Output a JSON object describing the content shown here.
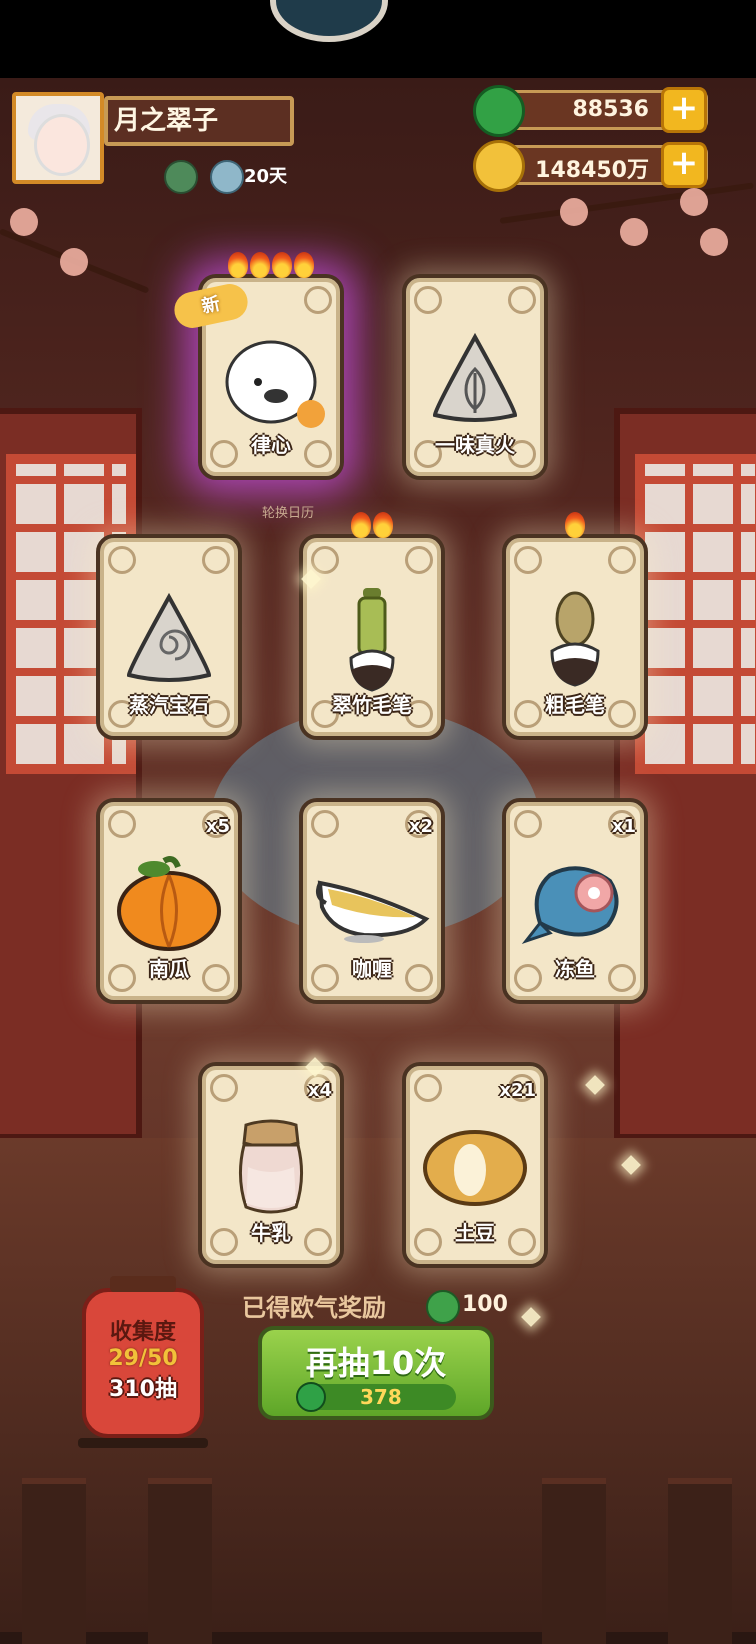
{
  "player": {
    "name": "月之翠子",
    "days": "20天"
  },
  "currency": {
    "jade": "88536",
    "gold": "148450万"
  },
  "rotate_hint": "轮换日历",
  "cards": [
    {
      "label": "律心",
      "count": "",
      "flames": 4,
      "new": "新",
      "glow": "purple",
      "icon": "white-bird-icon"
    },
    {
      "label": "一味真火",
      "count": "",
      "flames": 0,
      "new": "",
      "glow": "light",
      "icon": "leaf-stone-icon"
    },
    {
      "label": "蒸汽宝石",
      "count": "",
      "flames": 0,
      "new": "",
      "glow": "light",
      "icon": "swirl-stone-icon"
    },
    {
      "label": "翠竹毛笔",
      "count": "",
      "flames": 2,
      "new": "",
      "glow": "light",
      "icon": "bamboo-brush-icon"
    },
    {
      "label": "粗毛笔",
      "count": "",
      "flames": 1,
      "new": "",
      "glow": "light",
      "icon": "coarse-brush-icon"
    },
    {
      "label": "南瓜",
      "count": "x5",
      "flames": 0,
      "new": "",
      "glow": "light",
      "icon": "pumpkin-icon"
    },
    {
      "label": "咖喱",
      "count": "x2",
      "flames": 0,
      "new": "",
      "glow": "light",
      "icon": "curry-boat-icon"
    },
    {
      "label": "冻鱼",
      "count": "x1",
      "flames": 0,
      "new": "",
      "glow": "light",
      "icon": "frozen-fish-icon"
    },
    {
      "label": "牛乳",
      "count": "x4",
      "flames": 0,
      "new": "",
      "glow": "light",
      "icon": "milk-jar-icon"
    },
    {
      "label": "土豆",
      "count": "x21",
      "flames": 0,
      "new": "",
      "glow": "light",
      "icon": "potato-icon"
    }
  ],
  "collection": {
    "title": "收集度",
    "progress": "29/50",
    "draws": "310抽"
  },
  "reward": {
    "label": "已得欧气奖励",
    "value": "100"
  },
  "draw_button": {
    "label": "再抽10次",
    "cost": "378"
  },
  "colors": {
    "accent_green": "#5ea628",
    "gold": "#f2b71f",
    "card_bg": "#f3e6c8"
  }
}
